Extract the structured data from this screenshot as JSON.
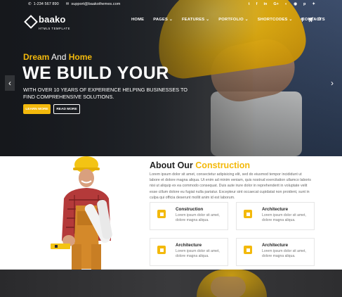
{
  "topbar": {
    "phone": "1-234 567 890",
    "email": "support@baakothemes.com",
    "social_icons": [
      "twitter-icon",
      "facebook-icon",
      "google-plus-icon",
      "github-icon",
      "dribbble-icon",
      "pinterest-icon",
      "vk-icon"
    ],
    "social_glyphs": [
      "𝕥",
      "f",
      "in",
      "G+",
      "⚙",
      "◉",
      "✦",
      "✧"
    ]
  },
  "logo": {
    "name": "baako",
    "tagline": "HTML5 TEMPLATE"
  },
  "nav": {
    "items": [
      {
        "label": "HOME"
      },
      {
        "label": "PAGES ⌄"
      },
      {
        "label": "FEATURES ⌄"
      },
      {
        "label": "PORTFOLIO ⌄"
      },
      {
        "label": "SHORTCODES ⌄"
      },
      {
        "label": "CONTACTS"
      }
    ],
    "cart_count": "0"
  },
  "hero": {
    "subtitle_1": "Dream",
    "subtitle_and": "And",
    "subtitle_2": "Home",
    "title": "WE BUILD YOUR",
    "text": "WITH OVER 10 YEARS OF EXPERIENCE HELPING BUSINESSES TO FIND COMPREHENSIVE SOLUTIONS.",
    "btn_primary": "LEARN MORE",
    "btn_secondary": "READ MORE"
  },
  "about": {
    "title_1": "About Our",
    "title_2": "Construction",
    "text": "Lorem ipsum dolor sit amet, consectetur adipisicing elit, sed do eiusmod tempor incididunt ut labore et dolore magna aliqua. Ut enim ad minim veniam, quis nostrud exercitation ullamco laboris nisi ut aliquip ex ea commodo consequat. Duis aute irure dolor in reprehenderit in voluptate velit esse cillum dolore eu fugiat nulla pariatur. Excepteur sint occaecat cupidatat non proident, sunt in culpa qui officia deserunt mollit anim id est laborum.",
    "features": [
      {
        "title": "Construction",
        "text": "Lorem ipsum dolor sit amet, dolore magna aliqua."
      },
      {
        "title": "Architecture",
        "text": "Lorem ipsum dolor sit amet, dolore magna aliqua."
      },
      {
        "title": "Architecture",
        "text": "Lorem ipsum dolor sit amet, dolore magna aliqua."
      },
      {
        "title": "Architecture",
        "text": "Lorem ipsum dolor sit amet, dolore magna aliqua."
      }
    ]
  },
  "colors": {
    "accent": "#f3b90c",
    "dark": "#1e2227"
  }
}
